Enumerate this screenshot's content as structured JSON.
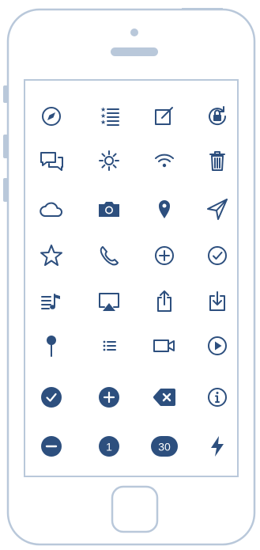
{
  "colors": {
    "outline": "#b9c8da",
    "icon": "#2d4f7e",
    "fill_badge": "#2d4f7e"
  },
  "grid": [
    [
      "compass-icon",
      "list-icon",
      "compose-icon",
      "rotation-lock-icon"
    ],
    [
      "chat-bubbles-icon",
      "brightness-icon",
      "wifi-icon",
      "trash-icon"
    ],
    [
      "cloud-icon",
      "camera-icon",
      "location-pin-icon",
      "paper-plane-icon"
    ],
    [
      "star-icon",
      "phone-icon",
      "add-circle-icon",
      "check-circle-icon"
    ],
    [
      "music-list-icon",
      "airplay-icon",
      "share-icon",
      "download-icon"
    ],
    [
      "map-pin-icon",
      "bullet-list-icon",
      "video-icon",
      "play-circle-icon"
    ],
    [
      "check-badge-icon",
      "add-badge-icon",
      "delete-badge-icon",
      "info-icon"
    ],
    [
      "minus-badge-icon",
      "badge-one-icon",
      "badge-thirty-icon",
      "lightning-icon"
    ]
  ],
  "badges": {
    "one": "1",
    "thirty": "30"
  }
}
